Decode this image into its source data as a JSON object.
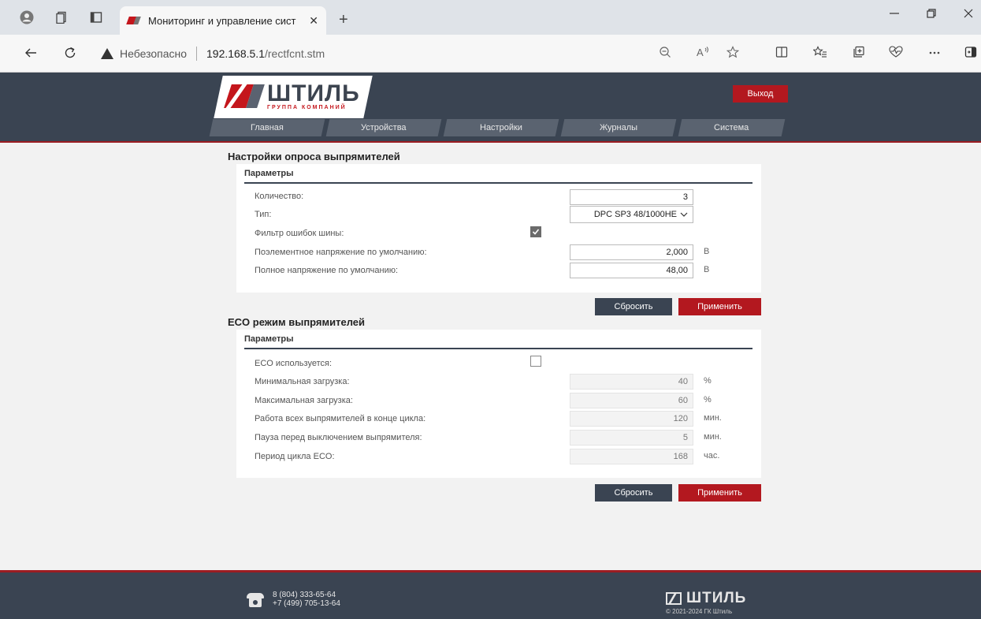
{
  "browser": {
    "tab_title": "Мониторинг и управление сист",
    "tab_close": "✕",
    "new_tab": "+",
    "security_label": "Небезопасно",
    "url_host": "192.168.5.1",
    "url_path": "/rectfcnt.stm"
  },
  "header": {
    "logo_text": "ШТИЛЬ",
    "logo_subtitle": "ГРУППА КОМПАНИЙ",
    "logout_label": "Выход",
    "menu": [
      {
        "label": "Главная"
      },
      {
        "label": "Устройства"
      },
      {
        "label": "Настройки"
      },
      {
        "label": "Журналы"
      },
      {
        "label": "Система"
      }
    ]
  },
  "poll": {
    "title": "Настройки опроса выпрямителей",
    "panel_title": "Параметры",
    "count_label": "Количество:",
    "count_value": "3",
    "type_label": "Тип:",
    "type_value": "DPC SP3 48/1000HE",
    "bus_filter_label": "Фильтр ошибок шины:",
    "bus_filter_checked": true,
    "elem_voltage_label": "Поэлементное напряжение по умолчанию:",
    "elem_voltage_value": "2,000",
    "elem_voltage_unit": "В",
    "full_voltage_label": "Полное напряжение по умолчанию:",
    "full_voltage_value": "48,00",
    "full_voltage_unit": "В",
    "reset_label": "Сбросить",
    "apply_label": "Применить"
  },
  "eco": {
    "title": "ECO режим выпрямителей",
    "panel_title": "Параметры",
    "used_label": "ECO используется:",
    "used_checked": false,
    "min_load_label": "Минимальная загрузка:",
    "min_load_value": "40",
    "min_load_unit": "%",
    "max_load_label": "Максимальная загрузка:",
    "max_load_value": "60",
    "max_load_unit": "%",
    "all_work_label": "Работа всех выпрямителей в конце цикла:",
    "all_work_value": "120",
    "all_work_unit": "мин.",
    "pause_label": "Пауза перед выключением выпрямителя:",
    "pause_value": "5",
    "pause_unit": "мин.",
    "period_label": "Период цикла ECO:",
    "period_value": "168",
    "period_unit": "час.",
    "reset_label": "Сбросить",
    "apply_label": "Применить"
  },
  "footer": {
    "phone1": "8 (804) 333-65-64",
    "phone2": "+7 (499) 705-13-64",
    "logo_text": "ШТИЛЬ",
    "copyright": "© 2021-2024 ГК Штиль"
  }
}
